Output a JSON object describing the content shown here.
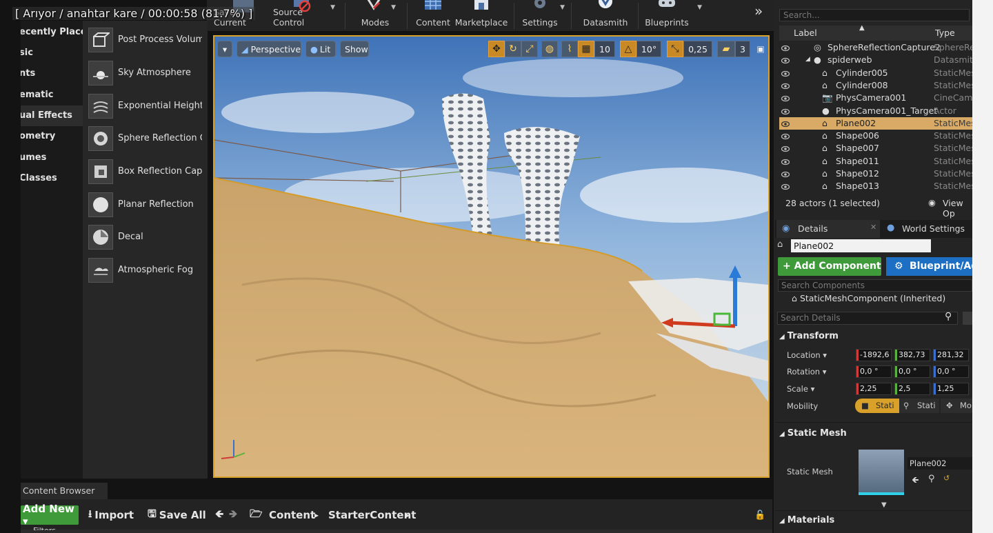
{
  "status_overlay": "[ Arıyor / anahtar kare / 00:00:58 (81.7%) ]",
  "toolbar": {
    "items": [
      {
        "label": "Save Current"
      },
      {
        "label": "Source Control"
      },
      {
        "label": "Modes"
      },
      {
        "label": "Content"
      },
      {
        "label": "Marketplace"
      },
      {
        "label": "Settings"
      },
      {
        "label": "Datasmith"
      },
      {
        "label": "Blueprints"
      }
    ],
    "expand_icon": "»"
  },
  "place_modes": {
    "categories": [
      "ecently Placed",
      "sic",
      "nts",
      "ematic",
      "ual Effects",
      "ometry",
      "umes",
      "Classes"
    ],
    "selected_category_index": 4,
    "items": [
      "Post Process Volume",
      "Sky Atmosphere",
      "Exponential Height Fog",
      "Sphere Reflection Capture",
      "Box Reflection Capture",
      "Planar Reflection",
      "Decal",
      "Atmospheric Fog"
    ]
  },
  "viewport": {
    "view_mode": "Perspective",
    "lighting": "Lit",
    "show": "Show",
    "grid_snap": "10",
    "rotation_snap": "10°",
    "scale_snap": "0,25",
    "camera_speed": "3"
  },
  "outliner": {
    "search_placeholder": "Search...",
    "col_label": "Label",
    "col_type": "Type",
    "rows": [
      {
        "name": "SphereReflectionCapture2",
        "type": "SphereRef",
        "indent": 0,
        "icon": "reflection-icon"
      },
      {
        "name": "spiderweb",
        "type": "Datasmith",
        "indent": 0,
        "icon": "sphere-icon"
      },
      {
        "name": "Cylinder005",
        "type": "StaticMesh",
        "indent": 1,
        "icon": "mesh-icon"
      },
      {
        "name": "Cylinder008",
        "type": "StaticMesh",
        "indent": 1,
        "icon": "mesh-icon"
      },
      {
        "name": "PhysCamera001",
        "type": "CineCame",
        "indent": 1,
        "icon": "camera-icon"
      },
      {
        "name": "PhysCamera001_Target",
        "type": "Actor",
        "indent": 1,
        "icon": "sphere-icon"
      },
      {
        "name": "Plane002",
        "type": "StaticMesh",
        "indent": 1,
        "icon": "mesh-icon",
        "selected": true
      },
      {
        "name": "Shape006",
        "type": "StaticMesh",
        "indent": 1,
        "icon": "mesh-icon"
      },
      {
        "name": "Shape007",
        "type": "StaticMesh",
        "indent": 1,
        "icon": "mesh-icon"
      },
      {
        "name": "Shape011",
        "type": "StaticMesh",
        "indent": 1,
        "icon": "mesh-icon"
      },
      {
        "name": "Shape012",
        "type": "StaticMesh",
        "indent": 1,
        "icon": "mesh-icon"
      },
      {
        "name": "Shape013",
        "type": "StaticMesh",
        "indent": 1,
        "icon": "mesh-icon"
      }
    ],
    "footer": "28 actors (1 selected)",
    "view_options": "View Op"
  },
  "details": {
    "tab_details": "Details",
    "tab_world": "World Settings",
    "actor_name": "Plane002",
    "add_component": "+ Add Component ▾",
    "blueprint_add": "Blueprint/Add",
    "search_components_placeholder": "Search Components",
    "component": "StaticMeshComponent (Inherited)",
    "search_details_placeholder": "Search Details",
    "transform_header": "Transform",
    "location_label": "Location ▾",
    "rotation_label": "Rotation ▾",
    "scale_label": "Scale ▾",
    "mobility_label": "Mobility",
    "location": [
      "-1892,6",
      "382,73",
      "281,32"
    ],
    "rotation": [
      "0,0 °",
      "0,0 °",
      "0,0 °"
    ],
    "scale": [
      "2,25",
      "2,5",
      "1,25"
    ],
    "mobility": [
      "Stati",
      "Stati",
      "Mo"
    ],
    "static_mesh_header": "Static Mesh",
    "static_mesh_label": "Static Mesh",
    "static_mesh_value": "Plane002",
    "materials_header": "Materials"
  },
  "content_browser": {
    "tab": "Content Browser",
    "add_new": "Add New ▾",
    "import": "Import",
    "save_all": "Save All",
    "path": [
      "Content",
      "StarterContent"
    ],
    "filters": "Filters"
  },
  "colors": {
    "accent_selected": "#d9aa66",
    "viewport_border": "#d7a12b",
    "add_component": "#3f9a3a",
    "blueprint": "#1d6fc4"
  }
}
